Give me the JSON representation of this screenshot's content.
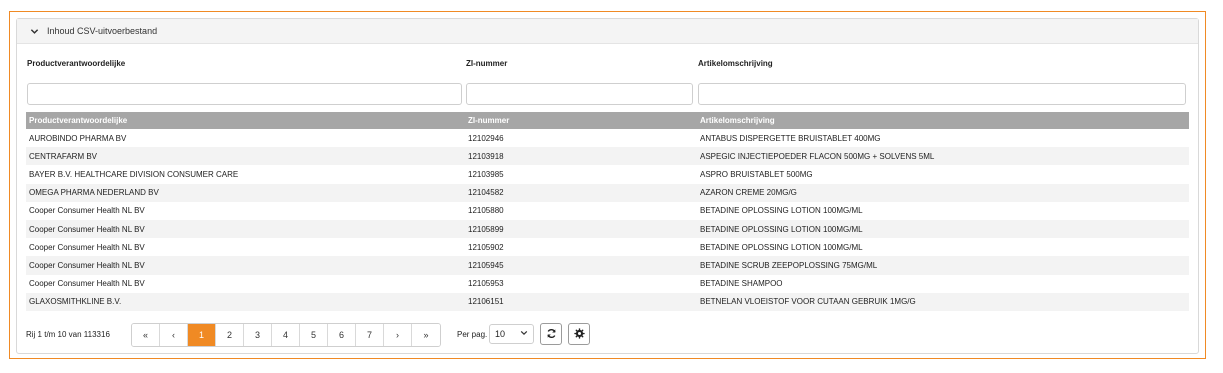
{
  "panel": {
    "title": "Inhoud CSV-uitvoerbestand"
  },
  "filters": {
    "producer_label": "Productverantwoordelijke",
    "zi_label": "ZI-nummer",
    "description_label": "Artikelomschrijving",
    "producer_value": "",
    "zi_value": "",
    "description_value": ""
  },
  "table": {
    "columns": [
      "Productverantwoordelijke",
      "ZI-nummer",
      "Artikelomschrijving"
    ],
    "rows": [
      [
        "AUROBINDO PHARMA BV",
        "12102946",
        "ANTABUS DISPERGETTE BRUISTABLET 400MG"
      ],
      [
        "CENTRAFARM BV",
        "12103918",
        "ASPEGIC INJECTIEPOEDER FLACON 500MG + SOLVENS 5ML"
      ],
      [
        "BAYER B.V. HEALTHCARE DIVISION CONSUMER CARE",
        "12103985",
        "ASPRO BRUISTABLET 500MG"
      ],
      [
        "OMEGA PHARMA NEDERLAND BV",
        "12104582",
        "AZARON CREME 20MG/G"
      ],
      [
        "Cooper Consumer Health NL BV",
        "12105880",
        "BETADINE OPLOSSING LOTION 100MG/ML"
      ],
      [
        "Cooper Consumer Health NL BV",
        "12105899",
        "BETADINE OPLOSSING LOTION 100MG/ML"
      ],
      [
        "Cooper Consumer Health NL BV",
        "12105902",
        "BETADINE OPLOSSING LOTION 100MG/ML"
      ],
      [
        "Cooper Consumer Health NL BV",
        "12105945",
        "BETADINE SCRUB ZEEPOPLOSSING 75MG/ML"
      ],
      [
        "Cooper Consumer Health NL BV",
        "12105953",
        "BETADINE SHAMPOO"
      ],
      [
        "GLAXOSMITHKLINE B.V.",
        "12106151",
        "BETNELAN VLOEISTOF VOOR CUTAAN GEBRUIK 1MG/G"
      ]
    ]
  },
  "footer": {
    "info": "Rij 1 t/m 10 van 113316",
    "pager": {
      "first": "«",
      "prev": "‹",
      "pages": [
        "1",
        "2",
        "3",
        "4",
        "5",
        "6",
        "7"
      ],
      "active_page": "1",
      "next": "›",
      "last": "»"
    },
    "per_page_label": "Per pag.",
    "per_page_value": "10"
  },
  "icons": {
    "collapse": "chevron-down-icon",
    "refresh": "refresh-icon",
    "settings": "gear-icon",
    "dropdown": "chevron-down-icon"
  },
  "colors": {
    "accent": "#f08a24",
    "table_header": "#a6a6a6",
    "row_alt": "#f3f3f3"
  }
}
